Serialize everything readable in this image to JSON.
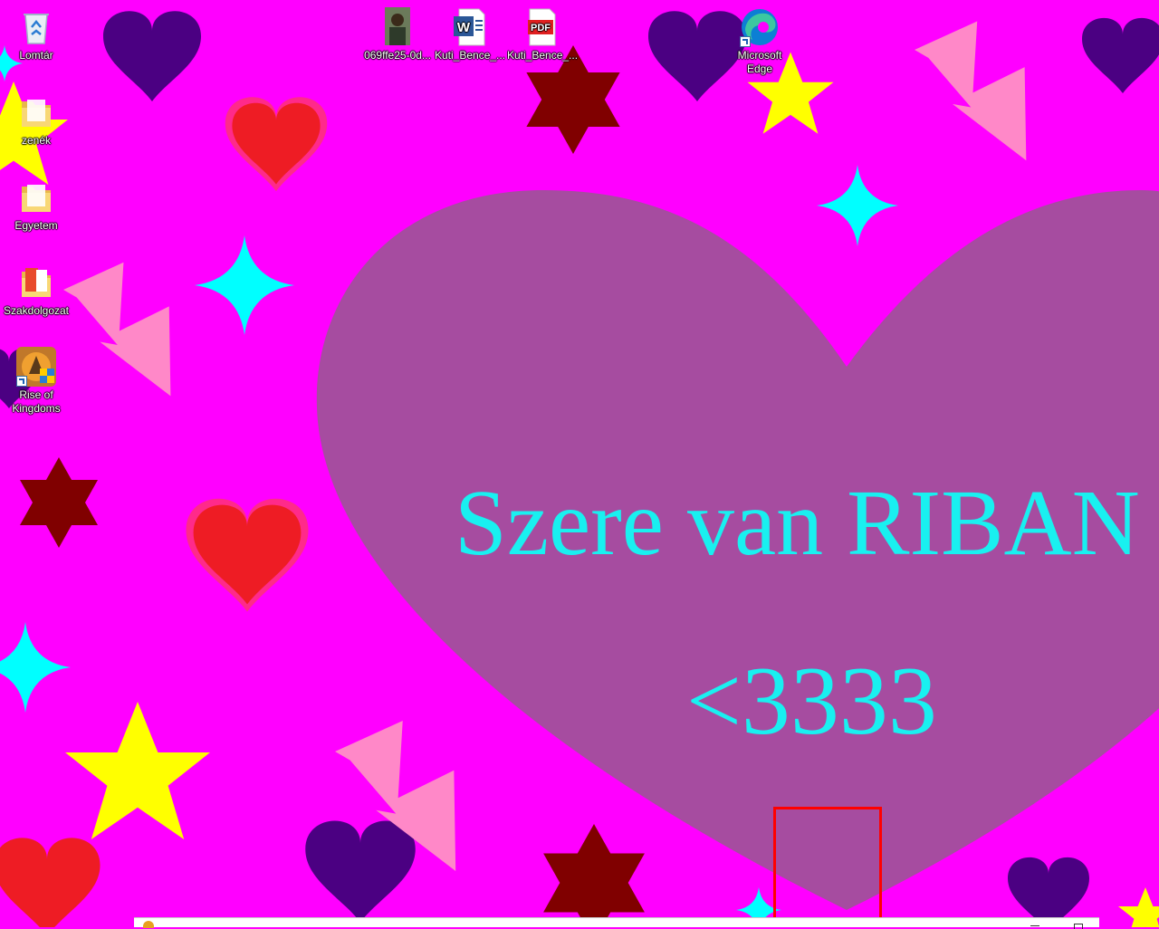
{
  "wallpaper": {
    "headline": "Szere van RIBAN",
    "sub": "<3333",
    "colors": {
      "background": "#ff00ff",
      "big_heart": "#a64ca0",
      "text": "#19f0f0",
      "dark_heart": "#4b0082",
      "red_heart": "#ee1c24",
      "star_yellow": "#ffff00",
      "star_dark": "#800000",
      "sparkle": "#00ffff",
      "bolt": "#ff88c8"
    }
  },
  "desktop_icons": [
    {
      "label": "Lomtár",
      "icon": "recycle-bin-icon"
    },
    {
      "label": "zenék",
      "icon": "folder-icon"
    },
    {
      "label": "Egyetem",
      "icon": "folder-icon"
    },
    {
      "label": "Szakdolgozat",
      "icon": "folder-icon"
    },
    {
      "label": "Rise of Kingdoms",
      "icon": "game-shortcut-icon"
    },
    {
      "label": "069ffe25-0d...",
      "icon": "image-file-icon"
    },
    {
      "label": "Kuti_Bence_...",
      "icon": "word-document-icon"
    },
    {
      "label": "Kuti_Bence_...",
      "icon": "pdf-document-icon"
    },
    {
      "label": "Microsoft Edge",
      "icon": "edge-browser-icon"
    }
  ],
  "pdf_badge": "PDF",
  "word_badge": "W"
}
